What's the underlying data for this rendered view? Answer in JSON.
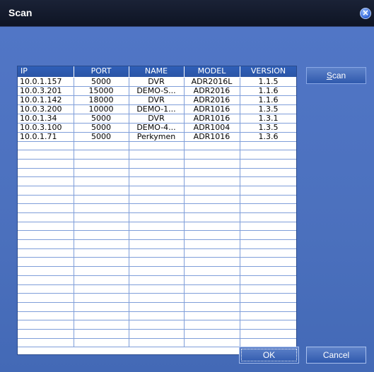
{
  "window": {
    "title": "Scan"
  },
  "buttons": {
    "scan_mnemonic": "S",
    "scan_rest": "can",
    "ok": "OK",
    "cancel": "Cancel"
  },
  "icons": {
    "close": "close-icon"
  },
  "table": {
    "columns": [
      "IP",
      "PORT",
      "NAME",
      "MODEL",
      "VERSION"
    ],
    "rows": [
      [
        "10.0.1.157",
        "5000",
        "DVR",
        "ADR2016L",
        "1.1.5"
      ],
      [
        "10.0.3.201",
        "15000",
        "DEMO-S...",
        "ADR2016",
        "1.1.6"
      ],
      [
        "10.0.1.142",
        "18000",
        "DVR",
        "ADR2016",
        "1.1.6"
      ],
      [
        "10.0.3.200",
        "10000",
        "DEMO-1...",
        "ADR1016",
        "1.3.5"
      ],
      [
        "10.0.1.34",
        "5000",
        "DVR",
        "ADR1016",
        "1.3.1"
      ],
      [
        "10.0.3.100",
        "5000",
        "DEMO-4...",
        "ADR1004",
        "1.3.5"
      ],
      [
        "10.0.1.71",
        "5000",
        "Perkymen",
        "ADR1016",
        "1.3.6"
      ]
    ]
  },
  "colors": {
    "title_bar": "#0e1424",
    "dialog_bg": "#4b70bd",
    "header_bg": "#2b55a6",
    "grid_line": "#7f9ed9"
  }
}
